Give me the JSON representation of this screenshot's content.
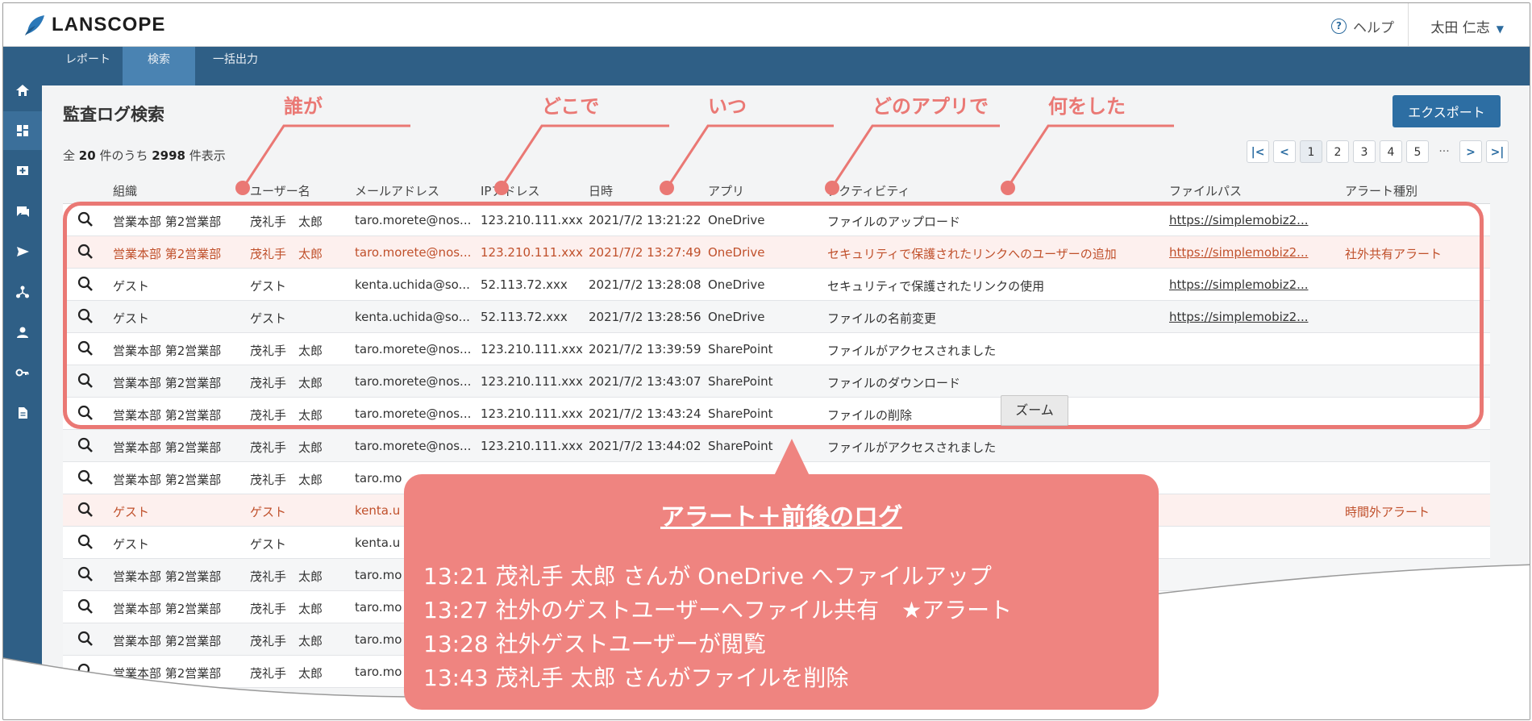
{
  "app": {
    "logo_text": "LANSCOPE",
    "help_label": "ヘルプ",
    "user_name": "太田 仁志"
  },
  "nav": {
    "tabs": [
      {
        "label": "レポート",
        "active": false
      },
      {
        "label": "検索",
        "active": true
      },
      {
        "label": "一括出力",
        "active": false
      }
    ]
  },
  "sidebar": {
    "icons": [
      "home-icon",
      "dashboard-icon",
      "add-box-icon",
      "chat-icon",
      "send-icon",
      "hierarchy-icon",
      "person-icon",
      "key-icon",
      "document-icon"
    ]
  },
  "page": {
    "title": "監査ログ検索",
    "export_label": "エクスポート",
    "count_prefix": "全",
    "count_per_page": "20",
    "count_mid": "件のうち",
    "count_total": "2998",
    "count_suffix": "件表示"
  },
  "pager": {
    "first": "|<",
    "prev": "<",
    "pages": [
      "1",
      "2",
      "3",
      "4",
      "5"
    ],
    "dots": "···",
    "next": ">",
    "last": ">|"
  },
  "table": {
    "headers": [
      "組織",
      "ユーザー名",
      "メールアドレス",
      "IPアドレス",
      "日時",
      "アプリ",
      "アクティビティ",
      "ファイルパス",
      "アラート種別"
    ],
    "rows": [
      {
        "org": "営業本部 第2営業部",
        "user": "茂礼手　太郎",
        "email": "taro.morete@nos...",
        "ip": "123.210.111.xxx",
        "dt": "2021/7/2  13:21:22",
        "app": "OneDrive",
        "activity": "ファイルのアップロード",
        "path": "https://simplemobiz2...",
        "alert": "",
        "is_alert": false
      },
      {
        "org": "営業本部 第2営業部",
        "user": "茂礼手　太郎",
        "email": "taro.morete@nos...",
        "ip": "123.210.111.xxx",
        "dt": "2021/7/2  13:27:49",
        "app": "OneDrive",
        "activity": "セキュリティで保護されたリンクへのユーザーの追加",
        "path": "https://simplemobiz2...",
        "alert": "社外共有アラート",
        "is_alert": true
      },
      {
        "org": "ゲスト",
        "user": "ゲスト",
        "email": "kenta.uchida@so...",
        "ip": "52.113.72.xxx",
        "dt": "2021/7/2  13:28:08",
        "app": "OneDrive",
        "activity": "セキュリティで保護されたリンクの使用",
        "path": "https://simplemobiz2...",
        "alert": "",
        "is_alert": false
      },
      {
        "org": "ゲスト",
        "user": "ゲスト",
        "email": "kenta.uchida@so...",
        "ip": "52.113.72.xxx",
        "dt": "2021/7/2  13:28:56",
        "app": "OneDrive",
        "activity": "ファイルの名前変更",
        "path": "https://simplemobiz2...",
        "alert": "",
        "is_alert": false
      },
      {
        "org": "営業本部 第2営業部",
        "user": "茂礼手　太郎",
        "email": "taro.morete@nos...",
        "ip": "123.210.111.xxx",
        "dt": "2021/7/2  13:39:59",
        "app": "SharePoint",
        "activity": "ファイルがアクセスされました",
        "path": "",
        "alert": "",
        "is_alert": false
      },
      {
        "org": "営業本部 第2営業部",
        "user": "茂礼手　太郎",
        "email": "taro.morete@nos...",
        "ip": "123.210.111.xxx",
        "dt": "2021/7/2  13:43:07",
        "app": "SharePoint",
        "activity": "ファイルのダウンロード",
        "path": "",
        "alert": "",
        "is_alert": false
      },
      {
        "org": "営業本部 第2営業部",
        "user": "茂礼手　太郎",
        "email": "taro.morete@nos...",
        "ip": "123.210.111.xxx",
        "dt": "2021/7/2  13:43:24",
        "app": "SharePoint",
        "activity": "ファイルの削除",
        "path": "",
        "alert": "",
        "is_alert": false
      },
      {
        "org": "営業本部 第2営業部",
        "user": "茂礼手　太郎",
        "email": "taro.morete@nos...",
        "ip": "123.210.111.xxx",
        "dt": "2021/7/2  13:44:02",
        "app": "SharePoint",
        "activity": "ファイルがアクセスされました",
        "path": "",
        "alert": "",
        "is_alert": false
      },
      {
        "org": "営業本部 第2営業部",
        "user": "茂礼手　太郎",
        "email": "taro.mo",
        "ip": "",
        "dt": "",
        "app": "",
        "activity": "",
        "path": "",
        "alert": "",
        "is_alert": false
      },
      {
        "org": "ゲスト",
        "user": "ゲスト",
        "email": "kenta.u",
        "ip": "",
        "dt": "",
        "app": "",
        "activity": "",
        "path": "",
        "alert": "時間外アラート",
        "is_alert": true
      },
      {
        "org": "ゲスト",
        "user": "ゲスト",
        "email": "kenta.u",
        "ip": "",
        "dt": "",
        "app": "",
        "activity": "",
        "path": "",
        "alert": "",
        "is_alert": false
      },
      {
        "org": "営業本部 第2営業部",
        "user": "茂礼手　太郎",
        "email": "taro.mo",
        "ip": "",
        "dt": "",
        "app": "",
        "activity": "",
        "path": "",
        "alert": "",
        "is_alert": false
      },
      {
        "org": "営業本部 第2営業部",
        "user": "茂礼手　太郎",
        "email": "taro.mo",
        "ip": "",
        "dt": "",
        "app": "",
        "activity": "",
        "path": "",
        "alert": "",
        "is_alert": false
      },
      {
        "org": "営業本部 第2営業部",
        "user": "茂礼手　太郎",
        "email": "taro.mo",
        "ip": "",
        "dt": "",
        "app": "",
        "activity": "",
        "path": "",
        "alert": "",
        "is_alert": false
      },
      {
        "org": "営業本部 第2営業部",
        "user": "茂礼手　太郎",
        "email": "taro.mo",
        "ip": "",
        "dt": "",
        "app": "",
        "activity": "",
        "path": "",
        "alert": "",
        "is_alert": false
      }
    ]
  },
  "annotations": {
    "labels": [
      "誰が",
      "どこで",
      "いつ",
      "どのアプリで",
      "何をした"
    ],
    "accent_color": "#ea7874"
  },
  "tooltip": {
    "zoom_label": "ズーム"
  },
  "callout": {
    "title": "アラート＋前後のログ",
    "lines": [
      "13:21 茂礼手 太郎 さんが OneDrive へファイルアップ",
      "13:27 社外のゲストユーザーへファイル共有　★アラート",
      "13:28 社外ゲストユーザーが閲覧",
      "13:43 茂礼手 太郎 さんがファイルを削除"
    ],
    "color": "#ef8480"
  },
  "colors": {
    "nav_bg": "#2f5f86",
    "active_tab": "#4a83b2",
    "export_btn": "#2d6ea3",
    "alert_text": "#c0502b"
  }
}
